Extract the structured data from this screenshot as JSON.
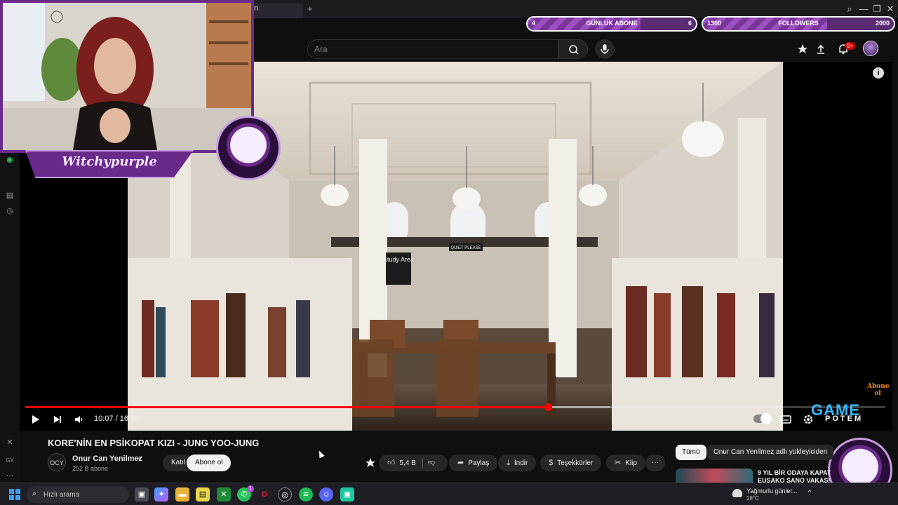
{
  "browser": {
    "tab_title": "n",
    "new_tab": "+",
    "window_controls": {
      "search": "⌕",
      "minimize": "—",
      "restore": "❐",
      "close": "✕"
    }
  },
  "sidebar": {
    "items": [
      {
        "icon": "whatsapp-icon",
        "glyph": "◉"
      },
      {
        "icon": "library-icon",
        "glyph": "▤"
      },
      {
        "icon": "clock-icon",
        "glyph": "◷"
      },
      {
        "icon": "twitch-icon",
        "glyph": "✕"
      },
      {
        "icon": "gx-icon",
        "glyph": "GX"
      },
      {
        "icon": "more-icon",
        "glyph": "⋯"
      }
    ]
  },
  "header": {
    "search_placeholder": "Ara",
    "notification_count": "9+"
  },
  "player": {
    "current_time": "10:07",
    "duration": "16:38",
    "time_text": "10:07 / 16:38",
    "progress_fraction": 0.608,
    "buffer_fraction": 0.68,
    "video_scene": {
      "sign_study_area": "Study Area",
      "sign_quiet": "QUIET PLEASE"
    }
  },
  "video": {
    "title": "KORE'NİN EN PSİKOPAT KIZI - JUNG YOO-JUNG",
    "channel_name": "Onur Can Yenilmez",
    "subscribers": "252 B abone",
    "join_label": "Katıl",
    "subscribe_label": "Abone ol",
    "likes": "5,4 B",
    "share_label": "Paylaş",
    "download_label": "İndir",
    "thanks_label": "Teşekkürler",
    "clip_label": "Klip",
    "more_label": "···"
  },
  "recommendations": {
    "chips": [
      "Tümü",
      "Onur Can Yenilmez adlı yükleyiciden"
    ],
    "first_title_line1": "9 YIL BİR ODAYA KAPAT",
    "first_title_line2": "EUSAKO SANO VAKASI"
  },
  "overlay": {
    "daily_goal": {
      "label": "GÜNLÜK ABONE",
      "current": "4",
      "target": "6",
      "fraction": 0.67
    },
    "followers_goal": {
      "label": "FOLLOWERS",
      "current": "1300",
      "target": "2000",
      "fraction": 0.65
    },
    "streamer_name": "Witchypurple",
    "gamepad_text": "GAME",
    "gamepad_sub": "POTEM",
    "abone_text": "Abone ol",
    "accent_color": "#6a2a8a"
  },
  "taskbar": {
    "search_placeholder": "Hızlı arama",
    "whatsapp_badge": "1",
    "weather_title": "Yağmurlu günler...",
    "weather_temp": "28°C"
  }
}
